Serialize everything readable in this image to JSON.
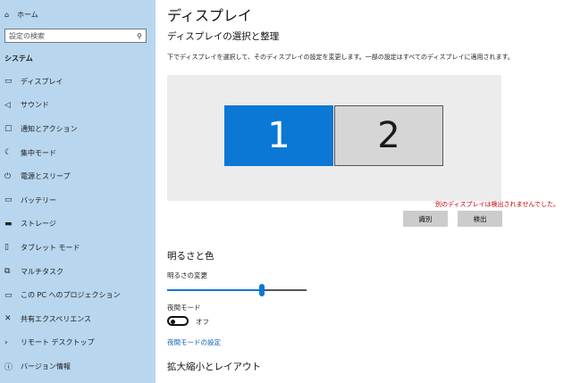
{
  "sidebar": {
    "home_label": "ホーム",
    "search_placeholder": "設定の検索",
    "section_label": "システム",
    "items": [
      {
        "label": "ディスプレイ",
        "icon": "monitor-icon"
      },
      {
        "label": "サウンド",
        "icon": "speaker-icon"
      },
      {
        "label": "通知とアクション",
        "icon": "notification-icon"
      },
      {
        "label": "集中モード",
        "icon": "moon-icon"
      },
      {
        "label": "電源とスリープ",
        "icon": "power-icon"
      },
      {
        "label": "バッテリー",
        "icon": "battery-icon"
      },
      {
        "label": "ストレージ",
        "icon": "storage-icon"
      },
      {
        "label": "タブレット モード",
        "icon": "tablet-icon"
      },
      {
        "label": "マルチタスク",
        "icon": "multitask-icon"
      },
      {
        "label": "この PC へのプロジェクション",
        "icon": "projection-icon"
      },
      {
        "label": "共有エクスペリエンス",
        "icon": "shared-experience-icon"
      },
      {
        "label": "リモート デスクトップ",
        "icon": "remote-desktop-icon"
      },
      {
        "label": "バージョン情報",
        "icon": "info-icon"
      }
    ]
  },
  "main": {
    "title": "ディスプレイ",
    "arrange": {
      "heading": "ディスプレイの選択と整理",
      "description": "下でディスプレイを選択して、そのディスプレイの設定を変更します。一部の設定はすべてのディスプレイに適用されます。",
      "monitors": [
        "1",
        "2"
      ],
      "selected_monitor": "1",
      "error": "別のディスプレイは検出されませんでした。",
      "identify_label": "識別",
      "detect_label": "検出"
    },
    "color": {
      "heading": "明るさと色",
      "brightness_label": "明るさの変更",
      "brightness_fraction": 0.68,
      "night_light_label": "夜間モード",
      "night_light_state": "オフ",
      "night_light_settings_link": "夜間モードの設定"
    },
    "scale": {
      "heading": "拡大縮小とレイアウト"
    }
  },
  "colors": {
    "sidebar_bg": "#b8d7ee",
    "accent": "#0a78d4",
    "error": "#c00000"
  }
}
